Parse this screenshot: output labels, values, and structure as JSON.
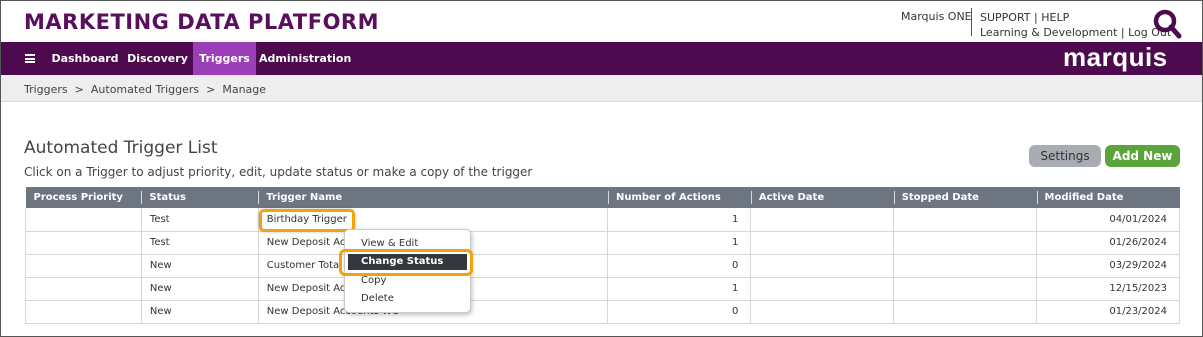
{
  "header": {
    "app_title": "MARKETING DATA PLATFORM",
    "user_link": "Marquis ONE",
    "support": "SUPPORT",
    "help": "HELP",
    "learning": "Learning & Development",
    "logout": "Log Out",
    "pipe": "|"
  },
  "nav": {
    "items": [
      {
        "label": "Dashboard"
      },
      {
        "label": "Discovery"
      },
      {
        "label": "Triggers",
        "active": true
      },
      {
        "label": "Administration"
      }
    ],
    "brand": "marquis",
    "active_color": "#9b3fb8",
    "bar_color": "#4e0a4f"
  },
  "breadcrumb": {
    "items": [
      "Triggers",
      "Automated Triggers",
      "Manage"
    ],
    "separator": ">"
  },
  "main": {
    "title": "Automated Trigger List",
    "subtitle": "Click on a Trigger to adjust priority, edit, update status or make a copy of the trigger",
    "settings_label": "Settings",
    "add_new_label": "Add New"
  },
  "table": {
    "columns": [
      "Process Priority",
      "Status",
      "Trigger Name",
      "Number of Actions",
      "Active Date",
      "Stopped Date",
      "Modified Date"
    ],
    "rows": [
      {
        "priority": "",
        "status": "Test",
        "name": "Birthday Trigger",
        "actions": "1",
        "active": "",
        "stopped": "",
        "modified": "04/01/2024"
      },
      {
        "priority": "",
        "status": "Test",
        "name": "New Deposit Acc",
        "actions": "1",
        "active": "",
        "stopped": "",
        "modified": "01/26/2024"
      },
      {
        "priority": "",
        "status": "New",
        "name": "Customer Total",
        "actions": "0",
        "active": "",
        "stopped": "",
        "modified": "03/29/2024"
      },
      {
        "priority": "",
        "status": "New",
        "name": "New Deposit Acc",
        "actions": "1",
        "active": "",
        "stopped": "",
        "modified": "12/15/2023"
      },
      {
        "priority": "",
        "status": "New",
        "name": "New Deposit Accounts WO",
        "actions": "0",
        "active": "",
        "stopped": "",
        "modified": "01/23/2024"
      }
    ]
  },
  "context_menu": {
    "items": [
      "View & Edit",
      "Change Status",
      "Copy",
      "Delete"
    ],
    "active_index": 1
  },
  "colors": {
    "highlight": "#f2a20c",
    "add_button": "#5aa43b",
    "title": "#5a0f5e"
  }
}
